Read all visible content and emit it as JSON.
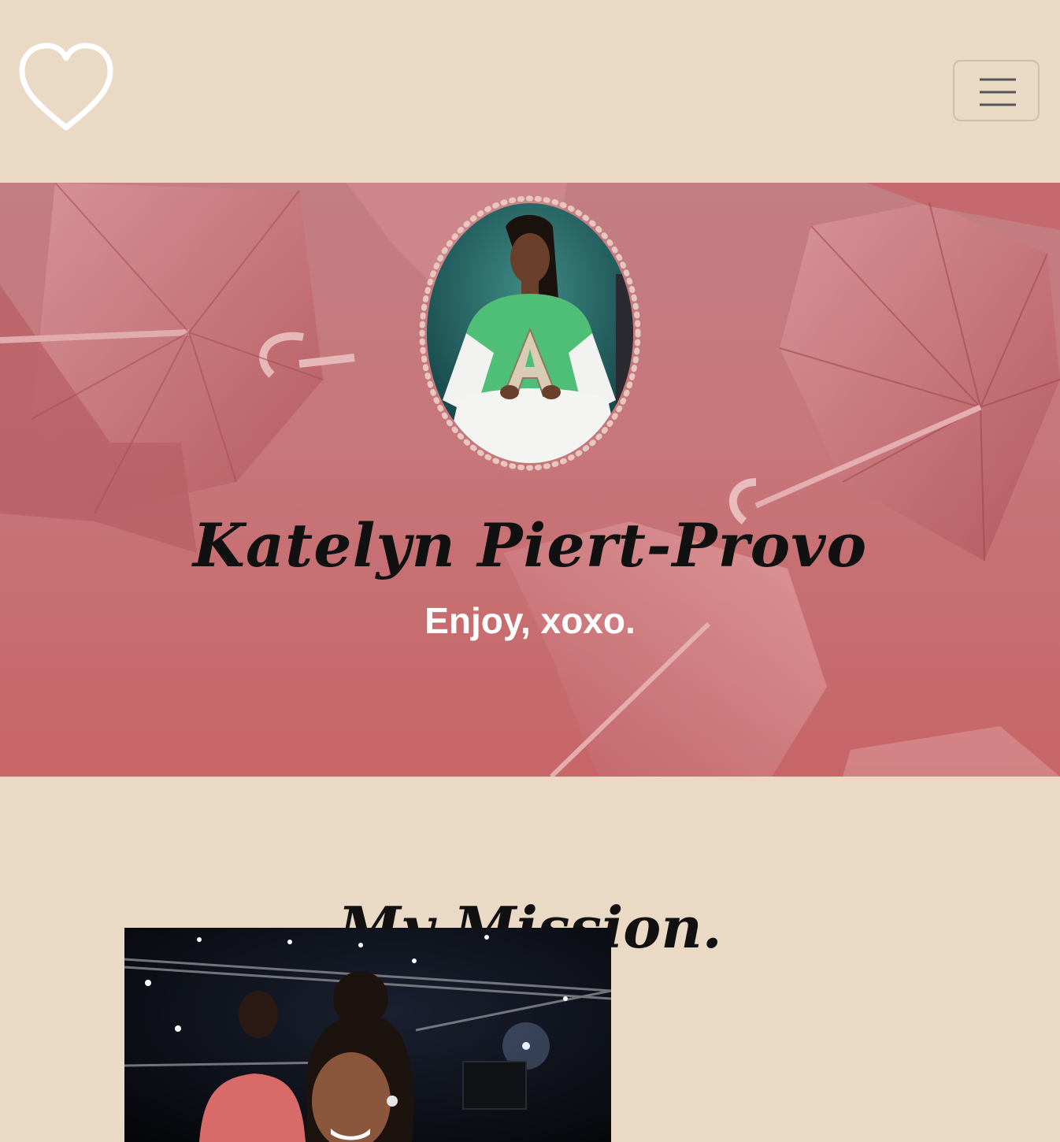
{
  "nav": {
    "logo_icon": "heart-outline-icon",
    "menu_icon": "hamburger-icon"
  },
  "hero": {
    "name": "Katelyn Piert-Provo",
    "tagline": "Enjoy, xoxo.",
    "background": "pink umbrellas",
    "portrait_letter": "A"
  },
  "mission": {
    "title": "My Mission."
  },
  "colors": {
    "page_background": "#eadac5",
    "hero_background": "#c7767a",
    "menu_border": "#cdbfad",
    "menu_icon": "#555555",
    "heading_text": "#111111",
    "tagline_text": "#ffffff",
    "portrait_border": "#e8c7c0",
    "jacket_green": "#4fbf77"
  }
}
